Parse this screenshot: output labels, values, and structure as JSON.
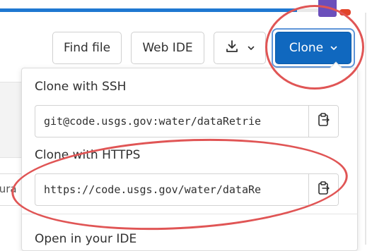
{
  "toolbar": {
    "find_file_label": "Find file",
    "web_ide_label": "Web IDE",
    "download_icon": "download-icon",
    "clone_label": "Clone"
  },
  "background": {
    "partial_input_text": "igura"
  },
  "clone_menu": {
    "ssh": {
      "title": "Clone with SSH",
      "value": "git@code.usgs.gov:water/dataRetrie",
      "copy_icon": "clipboard-icon"
    },
    "https": {
      "title": "Clone with HTTPS",
      "value": "https://code.usgs.gov/water/dataRe",
      "copy_icon": "clipboard-icon"
    },
    "ide": {
      "title": "Open in your IDE"
    }
  },
  "colors": {
    "accent": "#1068bf",
    "annotation": "#e05555",
    "progress": "#1f78d1"
  }
}
